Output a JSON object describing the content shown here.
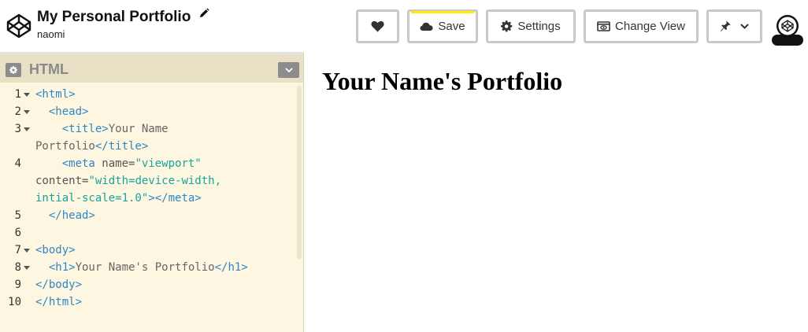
{
  "header": {
    "project_title": "My Personal Portfolio",
    "user_name": "naomi",
    "buttons": {
      "heart_icon": "heart-icon",
      "save_label": "Save",
      "settings_label": "Settings",
      "change_view_label": "Change View",
      "pin_icon": "pin-icon"
    },
    "save_accent_color": "#ffea00"
  },
  "editor": {
    "title": "HTML",
    "lines": [
      {
        "num": "1",
        "fold": true,
        "parts": [
          [
            "tag",
            "<html>"
          ]
        ]
      },
      {
        "num": "2",
        "fold": true,
        "parts": [
          [
            "txt",
            "  "
          ],
          [
            "tag",
            "<head>"
          ]
        ]
      },
      {
        "num": "3",
        "fold": true,
        "parts": [
          [
            "txt",
            "    "
          ],
          [
            "tag",
            "<title>"
          ],
          [
            "txt",
            "Your Name"
          ]
        ]
      },
      {
        "num": "",
        "fold": false,
        "parts": [
          [
            "txt",
            "Portfolio"
          ],
          [
            "tag",
            "</title>"
          ]
        ]
      },
      {
        "num": "4",
        "fold": false,
        "parts": [
          [
            "txt",
            "    "
          ],
          [
            "tag",
            "<meta "
          ],
          [
            "attr",
            "name="
          ],
          [
            "str",
            "\"viewport\""
          ]
        ]
      },
      {
        "num": "",
        "fold": false,
        "parts": [
          [
            "attr",
            "content="
          ],
          [
            "str",
            "\"width=device-width,"
          ]
        ]
      },
      {
        "num": "",
        "fold": false,
        "parts": [
          [
            "str",
            "intial-scale=1.0\""
          ],
          [
            "tag",
            "></meta>"
          ]
        ]
      },
      {
        "num": "5",
        "fold": false,
        "parts": [
          [
            "txt",
            "  "
          ],
          [
            "tag",
            "</head>"
          ]
        ]
      },
      {
        "num": "6",
        "fold": false,
        "parts": []
      },
      {
        "num": "7",
        "fold": true,
        "parts": [
          [
            "tag",
            "<body>"
          ]
        ]
      },
      {
        "num": "8",
        "fold": true,
        "parts": [
          [
            "txt",
            "  "
          ],
          [
            "tag",
            "<h1>"
          ],
          [
            "txt",
            "Your Name's Portfolio"
          ],
          [
            "tag",
            "</h1>"
          ]
        ]
      },
      {
        "num": "9",
        "fold": false,
        "parts": [
          [
            "tag",
            "</body>"
          ]
        ]
      },
      {
        "num": "10",
        "fold": false,
        "parts": [
          [
            "tag",
            "</html>"
          ]
        ]
      }
    ]
  },
  "preview": {
    "heading": "Your Name's Portfolio"
  }
}
